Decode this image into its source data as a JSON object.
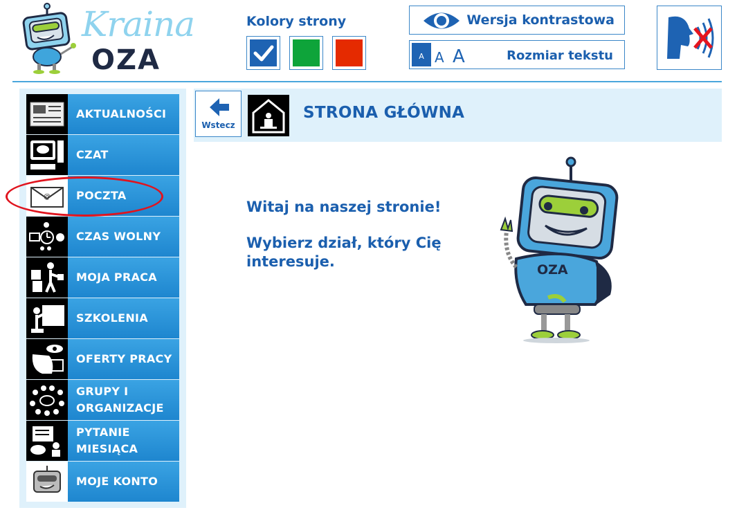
{
  "logo": {
    "line1": "Kraina",
    "line2": "OZA",
    "badge": "OZA"
  },
  "colors": {
    "label": "Kolory strony",
    "options": [
      {
        "name": "blue",
        "hex": "#1e63b3",
        "selected": true
      },
      {
        "name": "green",
        "hex": "#0ea43a",
        "selected": false
      },
      {
        "name": "red",
        "hex": "#e52a00",
        "selected": false
      }
    ]
  },
  "contrast": {
    "label": "Wersja kontrastowa",
    "icon": "eye-icon"
  },
  "font_size": {
    "label": "Rozmiar tekstu",
    "small": "A",
    "medium": "A",
    "large": "A"
  },
  "voice": {
    "icon": "speech-off-icon"
  },
  "sidebar": {
    "items": [
      {
        "label": "AKTUALNOŚCI",
        "icon": "newspaper-icon"
      },
      {
        "label": "CZAT",
        "icon": "computer-chat-icon"
      },
      {
        "label": "POCZTA",
        "icon": "mail-envelope-icon"
      },
      {
        "label": "CZAS WOLNY",
        "icon": "free-time-icon"
      },
      {
        "label": "MOJA PRACA",
        "icon": "worker-icon"
      },
      {
        "label": "SZKOLENIA",
        "icon": "training-icon"
      },
      {
        "label": "OFERTY PRACY",
        "icon": "job-offers-icon"
      },
      {
        "label": "GRUPY I ORGANIZACJE",
        "icon": "groups-icon"
      },
      {
        "label": "PYTANIE MIESIĄCA",
        "icon": "question-month-icon"
      },
      {
        "label": "MOJE KONTO",
        "icon": "robot-account-icon"
      }
    ]
  },
  "main": {
    "back_label": "Wstecz",
    "title": "STRONA GŁÓWNA",
    "welcome": "Witaj na naszej stronie!",
    "choose": "Wybierz dział, który Cię interesuje.",
    "robot_badge": "OZA"
  }
}
